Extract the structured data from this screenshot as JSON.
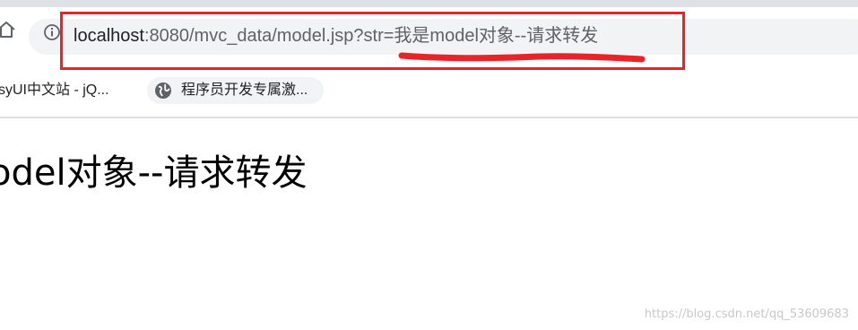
{
  "browser": {
    "address_bar": {
      "host": "localhost",
      "rest": ":8080/mvc_data/model.jsp?str=我是model对象--请求转发",
      "info_icon": "info-icon"
    },
    "home_icon": "home-icon",
    "bookmarks": [
      {
        "label": "syUI中文站 - jQ..."
      },
      {
        "label": "程序员开发专属激...",
        "icon": "globe-icon"
      }
    ]
  },
  "page": {
    "content_text": "odel对象--请求转发"
  },
  "watermark": "https://blog.csdn.net/qq_53609683",
  "colors": {
    "annotation_red": "#e8232a",
    "omnibox_bg": "#f1f3f4",
    "tab_strip": "#dee1e6"
  }
}
